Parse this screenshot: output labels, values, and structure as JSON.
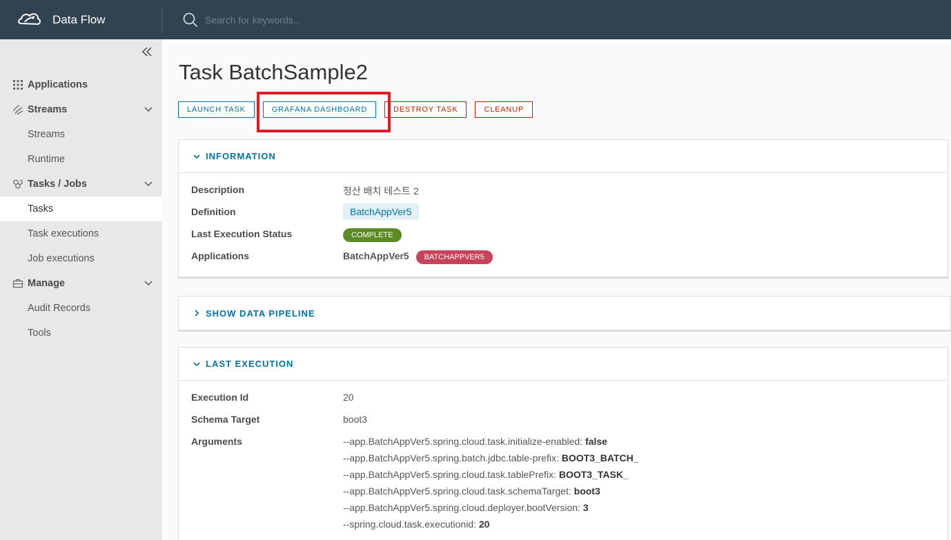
{
  "header": {
    "brand_title": "Data Flow",
    "search_placeholder": "Search for keywords..."
  },
  "sidebar": {
    "collapse_icon": "double-chevron-left-icon",
    "items": [
      {
        "type": "group",
        "label": "Applications",
        "icon": "grid-icon"
      },
      {
        "type": "group",
        "label": "Streams",
        "icon": "streams-icon",
        "expanded": true
      },
      {
        "type": "sub",
        "label": "Streams"
      },
      {
        "type": "sub",
        "label": "Runtime"
      },
      {
        "type": "group",
        "label": "Tasks / Jobs",
        "icon": "tasks-icon",
        "expanded": true
      },
      {
        "type": "sub",
        "label": "Tasks",
        "active": true
      },
      {
        "type": "sub",
        "label": "Task executions"
      },
      {
        "type": "sub",
        "label": "Job executions"
      },
      {
        "type": "group",
        "label": "Manage",
        "icon": "briefcase-icon",
        "expanded": true
      },
      {
        "type": "sub",
        "label": "Audit Records"
      },
      {
        "type": "sub",
        "label": "Tools"
      }
    ]
  },
  "main": {
    "title": "Task BatchSample2",
    "actions": {
      "launch": "LAUNCH TASK",
      "grafana": "GRAFANA DASHBOARD",
      "destroy": "DESTROY TASK",
      "cleanup": "CLEANUP"
    },
    "information": {
      "header": "INFORMATION",
      "description_label": "Description",
      "description_value": "정산 배치 테스트 2",
      "definition_label": "Definition",
      "definition_value": "BatchAppVer5",
      "status_label": "Last Execution Status",
      "status_value": "COMPLETE",
      "applications_label": "Applications",
      "application_name": "BatchAppVer5",
      "application_badge": "BATCHAPPVER5"
    },
    "pipeline": {
      "header": "SHOW DATA PIPELINE"
    },
    "last_execution": {
      "header": "LAST EXECUTION",
      "execution_id_label": "Execution Id",
      "execution_id_value": "20",
      "schema_target_label": "Schema Target",
      "schema_target_value": "boot3",
      "arguments_label": "Arguments",
      "arguments": [
        {
          "key": "--app.BatchAppVer5.spring.cloud.task.initialize-enabled: ",
          "value": "false"
        },
        {
          "key": "--app.BatchAppVer5.spring.batch.jdbc.table-prefix: ",
          "value": "BOOT3_BATCH_"
        },
        {
          "key": "--app.BatchAppVer5.spring.cloud.task.tablePrefix: ",
          "value": "BOOT3_TASK_"
        },
        {
          "key": "--app.BatchAppVer5.spring.cloud.task.schemaTarget: ",
          "value": "boot3"
        },
        {
          "key": "--app.BatchAppVer5.spring.cloud.deployer.bootVersion: ",
          "value": "3"
        },
        {
          "key": "--spring.cloud.task.executionid: ",
          "value": "20"
        }
      ]
    }
  },
  "colors": {
    "header_bg": "#314351",
    "accent": "#0072a3",
    "danger": "#c21d00",
    "success": "#5c8a24",
    "app_badge": "#c8425a",
    "highlight": "#e01b24"
  }
}
